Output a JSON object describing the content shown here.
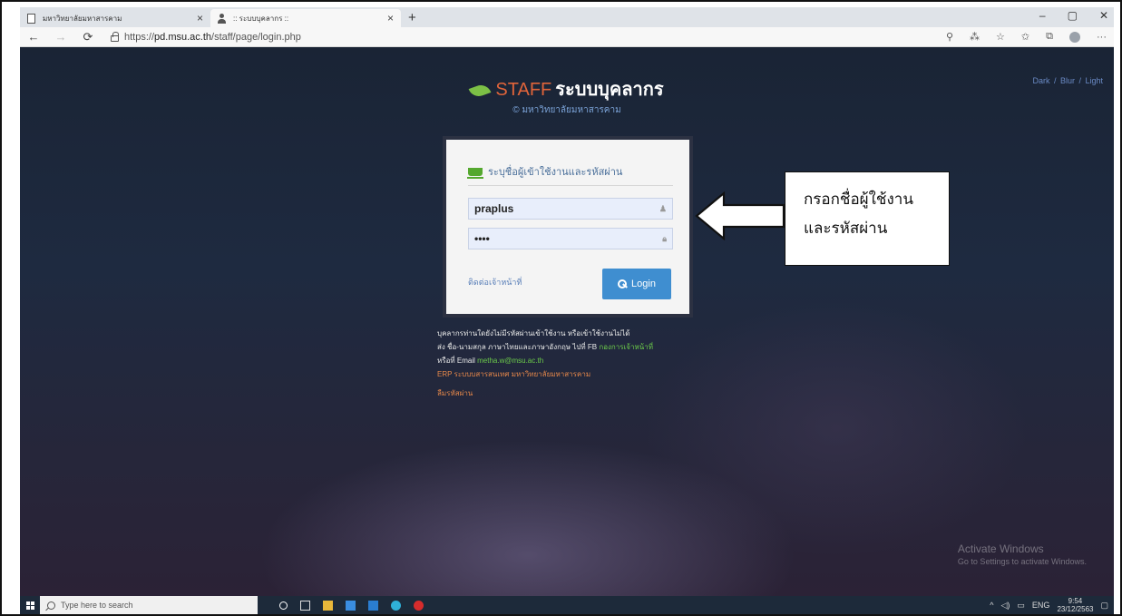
{
  "browser": {
    "tabs": [
      {
        "title": "มหาวิทยาลัยมหาสารคาม",
        "active": false,
        "icon": "page-icon"
      },
      {
        "title": ":: ระบบบุคลากร ::",
        "active": true,
        "icon": "person-icon"
      }
    ],
    "new_tab": "+",
    "window_controls": [
      "–",
      "▢",
      "✕"
    ],
    "nav": {
      "back": "←",
      "forward": "→",
      "refresh": "⟳"
    },
    "url_prefix": "https://",
    "url_host": "pd.msu.ac.th",
    "url_path": "/staff/page/login.php"
  },
  "page": {
    "brand_en": "STAFF",
    "brand_th": "ระบบบุคลากร",
    "university": "© มหาวิทยาลัยมหาสารคาม",
    "theme_links": "Dark / Blur / Light",
    "login": {
      "heading": "ระบุชื่อผู้เข้าใช้งานและรหัสผ่าน",
      "username": "praplus",
      "password": "••••",
      "contact_link": "ติดต่อเจ้าหน้าที่",
      "login_button": "Login"
    },
    "info": {
      "line1": "บุคลากรท่านใดยังไม่มีรหัสผ่านเข้าใช้งาน หรือเข้าใช้งานไม่ได้",
      "line2_prefix": "ส่ง ชื่อ-นามสกุล ภาษาไทยและภาษาอังกฤษ ไปที่ FB",
      "line2_link": "กองการเจ้าหน้าที่",
      "line3_prefix": "หรือที่ Email",
      "line3_email": "metha.w@msu.ac.th",
      "line4": "ERP ระบบบสารสนเทศ มหาวิทยาลัยมหาสารคาม",
      "forgot": "ลืมรหัสผ่าน"
    },
    "activate_title": "Activate Windows",
    "activate_sub": "Go to Settings to activate Windows."
  },
  "taskbar": {
    "search_placeholder": "Type here to search",
    "lang": "ENG",
    "time": "9:54",
    "date": "23/12/2563"
  },
  "callout": {
    "line1": "กรอกชื่อผู้ใช้งาน",
    "line2": "และรหัสผ่าน"
  }
}
